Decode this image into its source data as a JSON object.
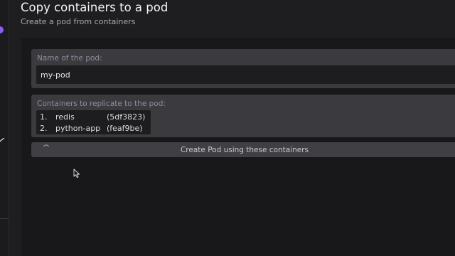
{
  "header": {
    "title": "Copy containers to a pod",
    "subtitle": "Create a pod from containers"
  },
  "pod_name": {
    "label": "Name of the pod:",
    "value": "my-pod"
  },
  "containers": {
    "label": "Containers to replicate to the pod:",
    "items": [
      {
        "index": "1.",
        "name": "redis",
        "id": "(5df3823)"
      },
      {
        "index": "2.",
        "name": "python-app",
        "id": "(feaf9be)"
      }
    ]
  },
  "create_button": {
    "label": "Create Pod using these containers"
  },
  "icons": {
    "spinner": "spinner-icon",
    "cursor": "mouse-pointer-icon",
    "nav_indicator": "status-dot-icon",
    "nav_check": "check-icon"
  },
  "colors": {
    "accent": "#8b5cf6",
    "background": "#1e1e21",
    "panel": "#18181b",
    "card": "#3a3a3f"
  }
}
